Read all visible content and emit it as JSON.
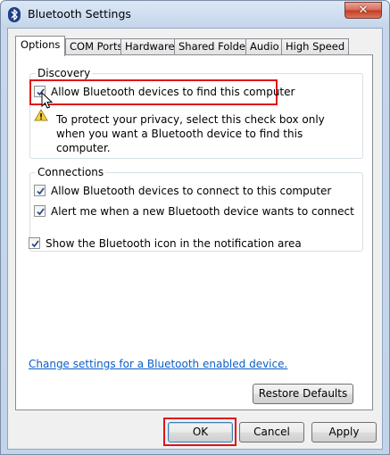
{
  "window": {
    "title": "Bluetooth Settings",
    "close_glyph": "✕"
  },
  "tabs": [
    "Options",
    "COM Ports",
    "Hardware",
    "Shared Folder",
    "Audio",
    "High Speed"
  ],
  "active_tab": "Options",
  "discovery": {
    "legend": "Discovery",
    "allow_find_label": "Allow Bluetooth devices to find this computer",
    "allow_find_checked": true,
    "warning_text": "To protect your privacy, select this check box only when you want a Bluetooth device to find this computer."
  },
  "connections": {
    "legend": "Connections",
    "allow_connect_label": "Allow Bluetooth devices to connect to this computer",
    "allow_connect_checked": true,
    "alert_label": "Alert me when a new Bluetooth device wants to connect",
    "alert_checked": true
  },
  "show_icon_label": "Show the Bluetooth icon in the notification area",
  "show_icon_checked": true,
  "change_settings_link": "Change settings for a Bluetooth enabled device.",
  "buttons": {
    "restore_defaults": "Restore Defaults",
    "ok": "OK",
    "cancel": "Cancel",
    "apply": "Apply"
  },
  "colors": {
    "highlight": "#e0131c",
    "link": "#0b5ec9",
    "title_bar": "#c6d7ec"
  }
}
